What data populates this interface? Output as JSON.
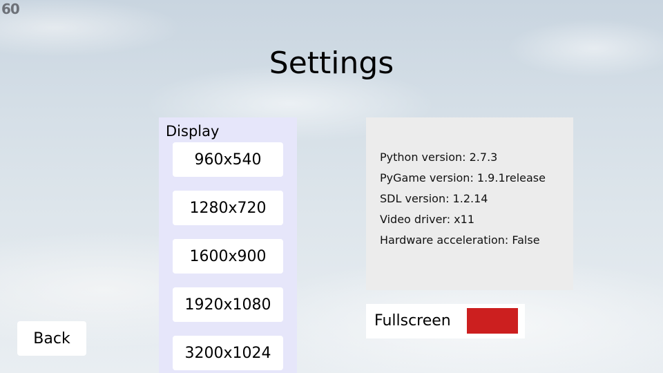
{
  "fps_counter": "60",
  "title": "Settings",
  "display": {
    "label": "Display",
    "resolutions": [
      "960x540",
      "1280x720",
      "1600x900",
      "1920x1080",
      "3200x1024"
    ]
  },
  "info": {
    "lines": [
      "Python version: 2.7.3",
      "PyGame version: 1.9.1release",
      "SDL version: 1.2.14",
      "Video driver: x11",
      "Hardware acceleration: False"
    ]
  },
  "fullscreen": {
    "label": "Fullscreen",
    "enabled": false,
    "toggle_color": "#cc1f1f"
  },
  "back_label": "Back",
  "colors": {
    "display_panel_bg": "#e6e6fa",
    "info_panel_bg": "#ececec",
    "button_bg": "#ffffff"
  }
}
